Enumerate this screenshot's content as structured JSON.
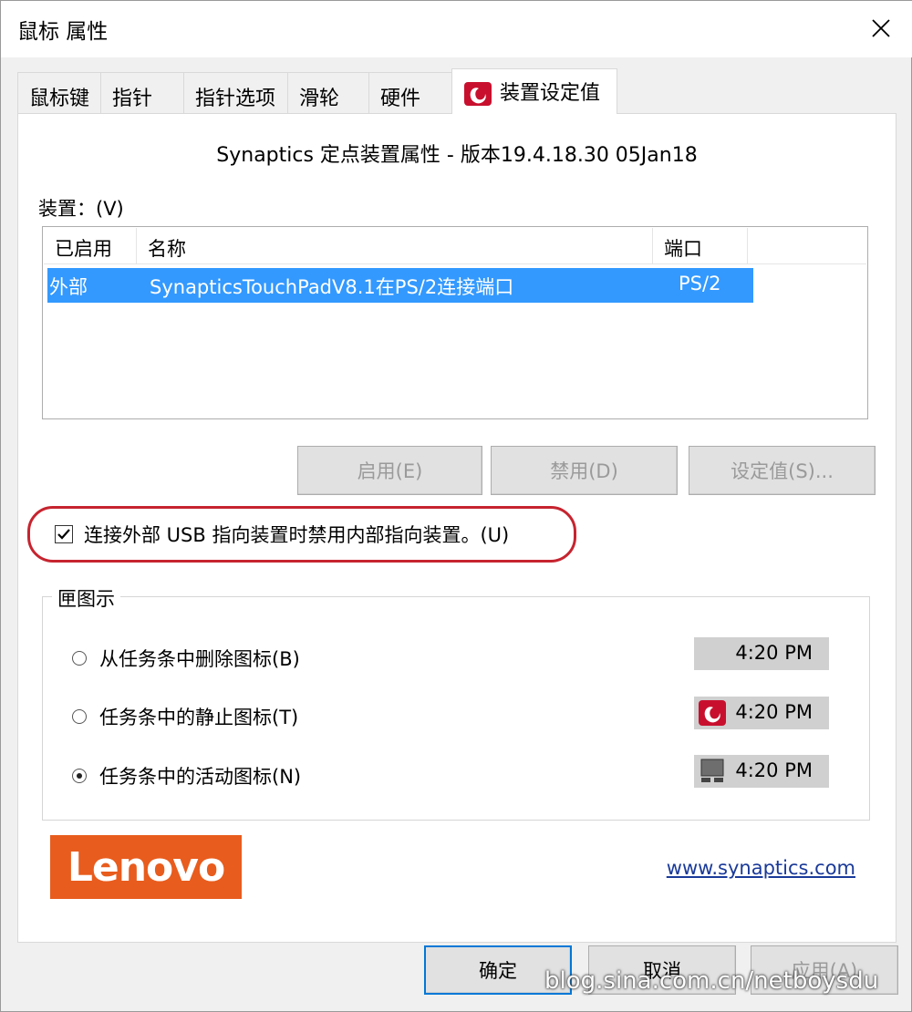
{
  "window": {
    "title": "鼠标 属性"
  },
  "tabs": [
    {
      "label": "鼠标键"
    },
    {
      "label": "指针"
    },
    {
      "label": "指针选项"
    },
    {
      "label": "滑轮"
    },
    {
      "label": "硬件"
    },
    {
      "label": "装置设定值",
      "active": true,
      "icon": "synaptics-icon"
    }
  ],
  "panel": {
    "header": "Synaptics 定点装置属性 - 版本19.4.18.30 05Jan18",
    "device_label": "装置：(V)",
    "columns": [
      "已启用",
      "名称",
      "端口"
    ],
    "devices": [
      {
        "enabled": "外部",
        "name": "SynapticsTouchPadV8.1在PS/2连接端口",
        "port": "PS/2",
        "selected": true
      }
    ],
    "buttons": {
      "enable": "启用(E)",
      "disable": "禁用(D)",
      "settings": "设定值(S)..."
    },
    "checkbox": {
      "label": "连接外部 USB 指向装置时禁用内部指向装置。(U)",
      "checked": true
    },
    "tray_group": {
      "legend": "匣图示",
      "options": [
        {
          "label": "从任务条中删除图标(B)",
          "selected": false,
          "clock": "4:20 PM",
          "icon": "none"
        },
        {
          "label": "任务条中的静止图标(T)",
          "selected": false,
          "clock": "4:20 PM",
          "icon": "synaptics-red-icon"
        },
        {
          "label": "任务条中的活动图标(N)",
          "selected": true,
          "clock": "4:20 PM",
          "icon": "touchpad-gray-icon"
        }
      ]
    },
    "logo_text": "Lenovo",
    "link": "www.synaptics.com"
  },
  "footer": {
    "ok": "确定",
    "cancel": "取消",
    "apply": "应用(A)"
  },
  "watermark": "blog.sina.com.cn/netboysdu",
  "colors": {
    "selection": "#3399ff",
    "highlight_ring": "#c6242f",
    "lenovo": "#e85c1d",
    "link": "#1a3a99",
    "focus_border": "#0078d7"
  }
}
